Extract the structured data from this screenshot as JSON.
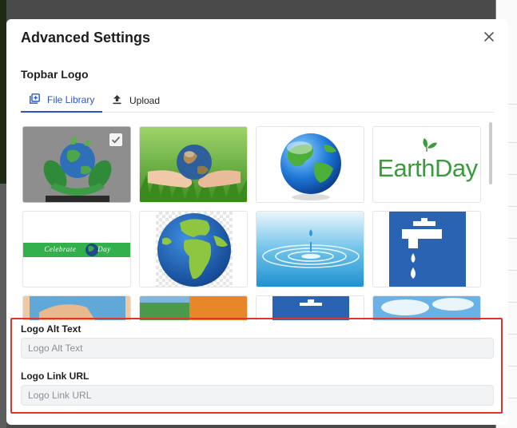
{
  "modal": {
    "title": "Advanced Settings",
    "section_label": "Topbar Logo",
    "tabs": [
      {
        "label": "File Library",
        "active": true,
        "icon": "add-image-icon"
      },
      {
        "label": "Upload",
        "active": false,
        "icon": "upload-icon"
      }
    ],
    "library": {
      "selected_index": 0,
      "tiles": [
        {
          "name": "earth-hands-logo",
          "text": ""
        },
        {
          "name": "hands-holding-globe-photo",
          "text": ""
        },
        {
          "name": "glossy-globe",
          "text": ""
        },
        {
          "name": "earthday-wordmark",
          "text": "EarthDay"
        },
        {
          "name": "celebrate-earth-day-banner",
          "text": "Celebrate Day"
        },
        {
          "name": "globe-africa-europe",
          "text": ""
        },
        {
          "name": "water-drop-ripple",
          "text": ""
        },
        {
          "name": "water-tap-drops",
          "text": ""
        }
      ]
    },
    "fields": {
      "alt_text_label": "Logo Alt Text",
      "alt_text_placeholder": "Logo Alt Text",
      "link_url_label": "Logo Link URL",
      "link_url_placeholder": "Logo Link URL"
    }
  },
  "colors": {
    "accent": "#2b55c7",
    "highlight_border": "#e0332a"
  }
}
